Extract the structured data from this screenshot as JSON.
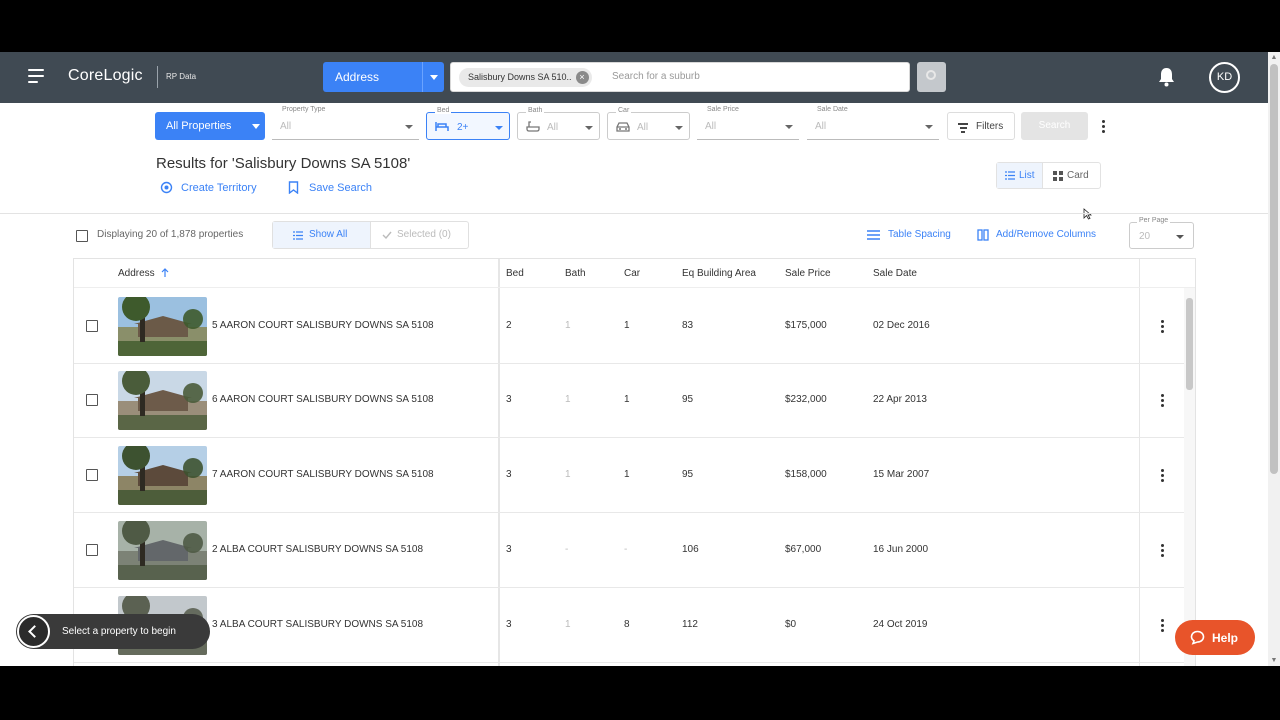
{
  "topbar": {
    "logo": "CoreLogic",
    "logo_sub": "RP Data",
    "search_mode": "Address",
    "chip": "Salisbury Downs SA 510..",
    "search_placeholder": "Search for a suburb",
    "avatar": "KD"
  },
  "filters": {
    "all_properties": "All Properties",
    "property_type": {
      "label": "Property Type",
      "value": "All"
    },
    "bed": {
      "label": "Bed",
      "value": "2+"
    },
    "bath": {
      "label": "Bath",
      "value": "All"
    },
    "car": {
      "label": "Car",
      "value": "All"
    },
    "sale_price": {
      "label": "Sale Price",
      "value": "All"
    },
    "sale_date": {
      "label": "Sale Date",
      "value": "All"
    },
    "filters_label": "Filters",
    "search_label": "Search"
  },
  "results": {
    "title": "Results for 'Salisbury Downs SA 5108'",
    "create_territory": "Create Territory",
    "save_search": "Save Search",
    "view_list": "List",
    "view_card": "Card"
  },
  "table_controls": {
    "displaying": "Displaying 20 of 1,878 properties",
    "show_all": "Show All",
    "selected": "Selected (0)",
    "table_spacing": "Table Spacing",
    "add_remove_columns": "Add/Remove Columns",
    "per_page_label": "Per Page",
    "per_page_value": "20"
  },
  "table": {
    "headers": [
      "Address",
      "Bed",
      "Bath",
      "Car",
      "Eq Building Area",
      "Sale Price",
      "Sale Date"
    ],
    "rows": [
      {
        "address": "5 AARON COURT SALISBURY DOWNS SA 5108",
        "bed": "2",
        "bath": "1",
        "car": "1",
        "area": "83",
        "price": "$175,000",
        "date": "02 Dec 2016"
      },
      {
        "address": "6 AARON COURT SALISBURY DOWNS SA 5108",
        "bed": "3",
        "bath": "1",
        "car": "1",
        "area": "95",
        "price": "$232,000",
        "date": "22 Apr 2013"
      },
      {
        "address": "7 AARON COURT SALISBURY DOWNS SA 5108",
        "bed": "3",
        "bath": "1",
        "car": "1",
        "area": "95",
        "price": "$158,000",
        "date": "15 Mar 2007"
      },
      {
        "address": "2 ALBA COURT SALISBURY DOWNS SA 5108",
        "bed": "3",
        "bath": "-",
        "car": "-",
        "area": "106",
        "price": "$67,000",
        "date": "16 Jun 2000"
      },
      {
        "address": "3 ALBA COURT SALISBURY DOWNS SA 5108",
        "bed": "3",
        "bath": "1",
        "car": "8",
        "area": "112",
        "price": "$0",
        "date": "24 Oct 2019"
      }
    ]
  },
  "overlays": {
    "toast": "Select a property to begin",
    "help": "Help"
  },
  "colors": {
    "topbar": "#404a53",
    "accent": "#3b82f6",
    "help": "#e8542a"
  }
}
